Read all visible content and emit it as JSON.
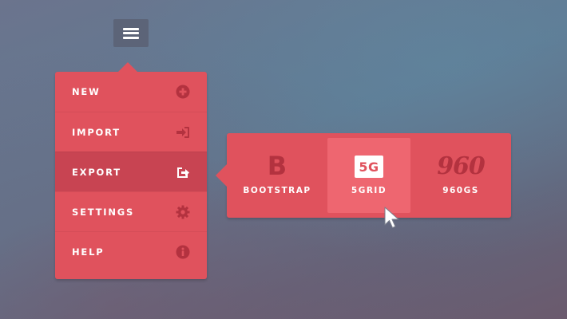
{
  "toggle": {
    "icon": "hamburger-menu-icon"
  },
  "menu": {
    "items": [
      {
        "label": "NEW",
        "icon": "plus-circle-icon",
        "active": false
      },
      {
        "label": "IMPORT",
        "icon": "sign-in-icon",
        "active": false
      },
      {
        "label": "EXPORT",
        "icon": "share-export-icon",
        "active": true
      },
      {
        "label": "SETTINGS",
        "icon": "gear-icon",
        "active": false
      },
      {
        "label": "HELP",
        "icon": "info-circle-icon",
        "active": false
      }
    ]
  },
  "submenu": {
    "items": [
      {
        "logo_text": "B",
        "label": "BOOTSTRAP",
        "icon": "bootstrap-logo-icon",
        "highlighted": false
      },
      {
        "logo_text": "5G",
        "label": "5GRID",
        "icon": "5grid-logo-icon",
        "highlighted": true
      },
      {
        "logo_text": "960",
        "label": "960GS",
        "icon": "960gs-logo-icon",
        "highlighted": false
      }
    ]
  },
  "colors": {
    "menu_bg": "#e0525d",
    "menu_active_bg": "#c84452",
    "sub_highlight_bg": "#ee6670",
    "logo_dark": "#b3323f",
    "toggle_bg": "#5c6478"
  },
  "cursor": {
    "icon": "mouse-pointer-icon"
  }
}
